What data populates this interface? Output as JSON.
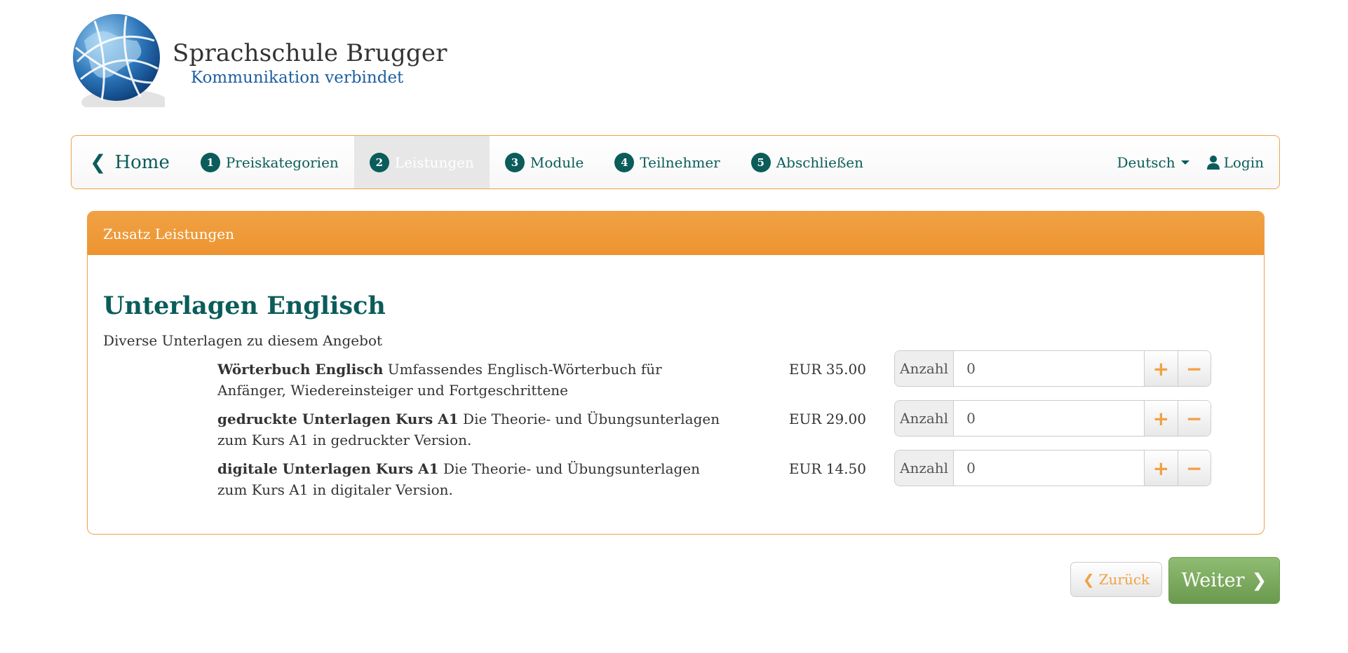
{
  "brand": {
    "name": "Sprachschule Brugger",
    "tagline": "Kommunikation verbindet"
  },
  "nav": {
    "home_label": "Home",
    "steps": [
      {
        "number": "1",
        "label": "Preiskategorien"
      },
      {
        "number": "2",
        "label": "Leistungen"
      },
      {
        "number": "3",
        "label": "Module"
      },
      {
        "number": "4",
        "label": "Teilnehmer"
      },
      {
        "number": "5",
        "label": "Abschließen"
      }
    ],
    "language": "Deutsch",
    "login_label": "Login"
  },
  "panel": {
    "heading": "Zusatz Leistungen",
    "title": "Unterlagen Englisch",
    "description": "Diverse Unterlagen zu diesem Angebot",
    "items": [
      {
        "name": "Wörterbuch Englisch",
        "description": "Umfassendes Englisch-Wörterbuch für Anfänger, Wiedereinsteiger und Fortgeschrittene",
        "price": "EUR 35.00",
        "qty_label": "Anzahl",
        "qty_value": "0"
      },
      {
        "name": "gedruckte Unterlagen Kurs A1",
        "description": "Die Theorie- und Übungsunterlagen zum Kurs A1 in gedruckter Version.",
        "price": "EUR 29.00",
        "qty_label": "Anzahl",
        "qty_value": "0"
      },
      {
        "name": "digitale Unterlagen Kurs A1",
        "description": "Die Theorie- und Übungsunterlagen zum Kurs A1 in digitaler Version.",
        "price": "EUR 14.50",
        "qty_label": "Anzahl",
        "qty_value": "0"
      }
    ]
  },
  "actions": {
    "back_label": "Zurück",
    "next_label": "Weiter"
  },
  "colors": {
    "accent": "#f0a144",
    "primary": "#0b5c5a",
    "success": "#7aa85e"
  },
  "icons": {
    "plus": "plus-icon",
    "minus": "minus-icon",
    "user": "user-icon",
    "chevron_left": "chevron-left-icon",
    "chevron_right": "chevron-right-icon"
  }
}
